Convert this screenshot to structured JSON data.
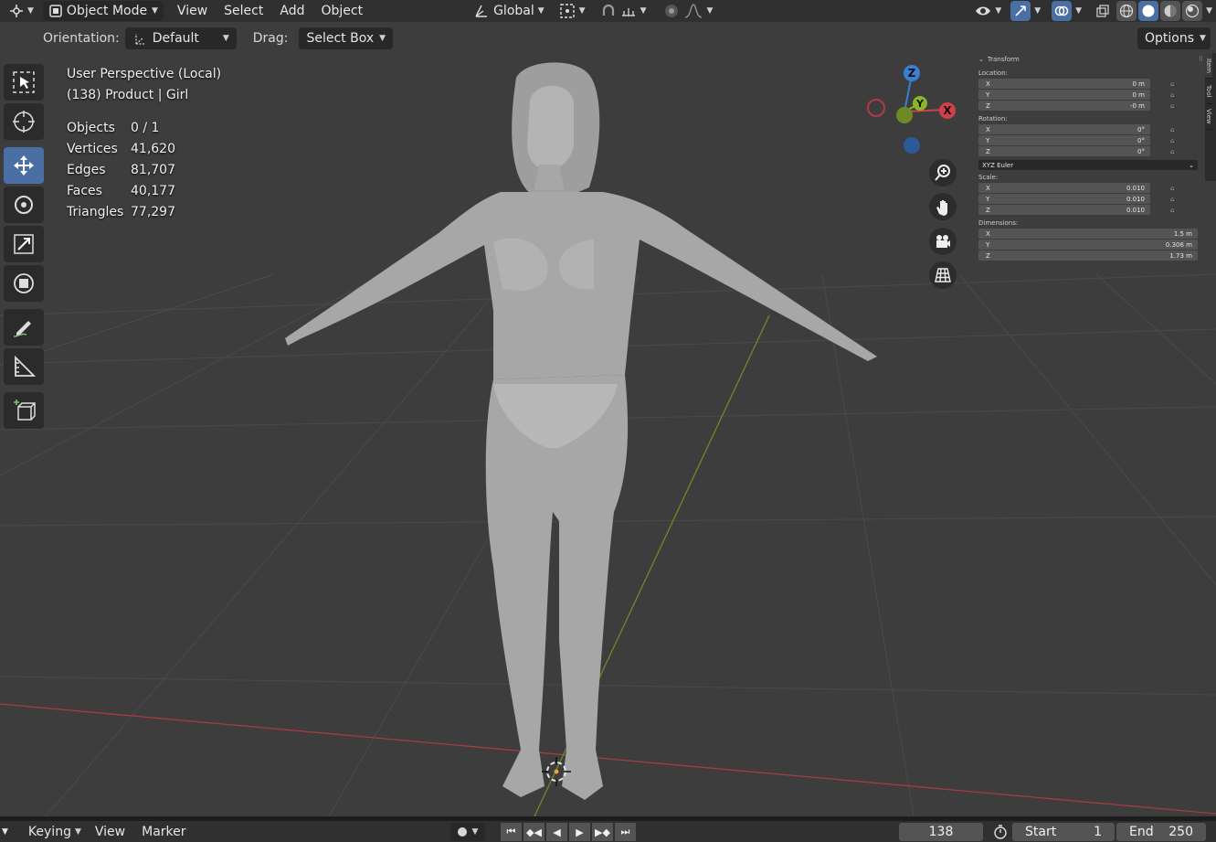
{
  "header": {
    "mode": "Object Mode",
    "menus": [
      "View",
      "Select",
      "Add",
      "Object"
    ],
    "transform_orientation": "Global"
  },
  "toolsettings": {
    "orientation_label": "Orientation:",
    "orientation_value": "Default",
    "drag_label": "Drag:",
    "drag_value": "Select Box",
    "options_label": "Options"
  },
  "overlay": {
    "view_name": "User Perspective (Local)",
    "object_name": "(138) Product | Girl",
    "stats": [
      {
        "key": "Objects",
        "value": "0 / 1"
      },
      {
        "key": "Vertices",
        "value": "41,620"
      },
      {
        "key": "Edges",
        "value": "81,707"
      },
      {
        "key": "Faces",
        "value": "40,177"
      },
      {
        "key": "Triangles",
        "value": "77,297"
      }
    ]
  },
  "gizmo": {
    "x": "X",
    "y": "Y",
    "z": "Z"
  },
  "npanel": {
    "title": "Transform",
    "location_label": "Location:",
    "location": [
      {
        "axis": "X",
        "value": "0 m"
      },
      {
        "axis": "Y",
        "value": "0 m"
      },
      {
        "axis": "Z",
        "value": "-0 m"
      }
    ],
    "rotation_label": "Rotation:",
    "rotation": [
      {
        "axis": "X",
        "value": "0°"
      },
      {
        "axis": "Y",
        "value": "0°"
      },
      {
        "axis": "Z",
        "value": "0°"
      }
    ],
    "rotation_mode": "XYZ Euler",
    "scale_label": "Scale:",
    "scale": [
      {
        "axis": "X",
        "value": "0.010"
      },
      {
        "axis": "Y",
        "value": "0.010"
      },
      {
        "axis": "Z",
        "value": "0.010"
      }
    ],
    "dimensions_label": "Dimensions:",
    "dimensions": [
      {
        "axis": "X",
        "value": "1.5 m"
      },
      {
        "axis": "Y",
        "value": "0.306 m"
      },
      {
        "axis": "Z",
        "value": "1.73 m"
      }
    ],
    "tabs": [
      "Item",
      "Tool",
      "View"
    ]
  },
  "timeline": {
    "keying": "Keying",
    "view": "View",
    "marker": "Marker",
    "current_frame": "138",
    "start_label": "Start",
    "start_value": "1",
    "end_label": "End",
    "end_value": "250"
  },
  "colors": {
    "accent": "#4a6fa5",
    "axis_x": "#d0404a",
    "axis_y": "#8ab825",
    "axis_z": "#3b7fd4"
  }
}
